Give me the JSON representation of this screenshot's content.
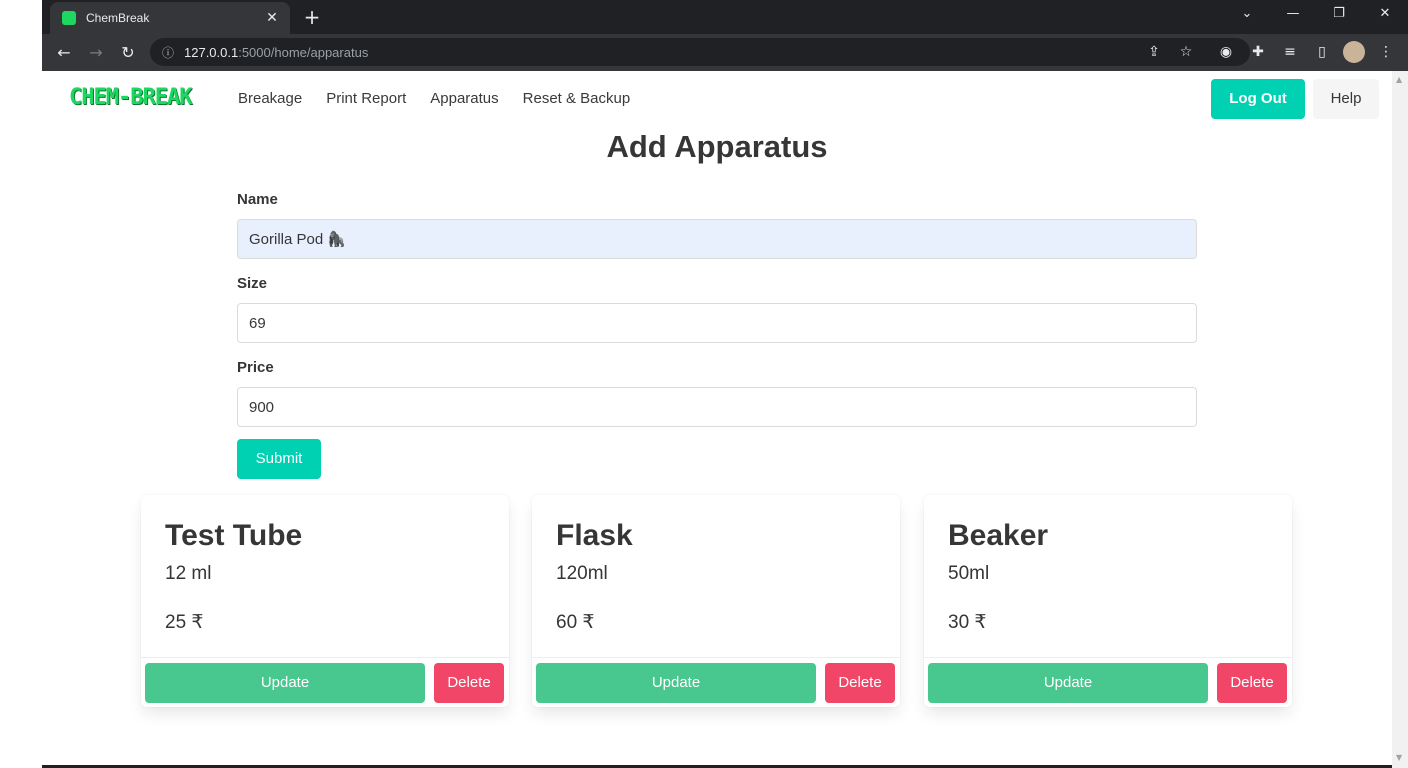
{
  "browser": {
    "tab_title": "ChemBreak",
    "tab_close": "✕",
    "new_tab": "+",
    "url_host": "127.0.0.1",
    "url_path": ":5000/home/apparatus",
    "window_controls": [
      "⌄",
      "—",
      "❐",
      "✕"
    ]
  },
  "navbar": {
    "logo": "CHEM-BREAK",
    "links": [
      "Breakage",
      "Print Report",
      "Apparatus",
      "Reset & Backup"
    ],
    "logout_label": "Log Out",
    "help_label": "Help"
  },
  "form": {
    "title": "Add Apparatus",
    "name_label": "Name",
    "name_value": "Gorilla Pod 🦍",
    "size_label": "Size",
    "size_value": "69",
    "price_label": "Price",
    "price_value": "900",
    "submit_label": "Submit"
  },
  "cards": [
    {
      "name": "Test Tube",
      "size": "12 ml",
      "price": "25 ₹",
      "update_label": "Update",
      "delete_label": "Delete"
    },
    {
      "name": "Flask",
      "size": "120ml",
      "price": "60 ₹",
      "update_label": "Update",
      "delete_label": "Delete"
    },
    {
      "name": "Beaker",
      "size": "50ml",
      "price": "30 ₹",
      "update_label": "Update",
      "delete_label": "Delete"
    }
  ],
  "colors": {
    "primary": "#00d1b2",
    "success": "#48c78e",
    "danger": "#f14668",
    "logo": "#1ed760"
  }
}
